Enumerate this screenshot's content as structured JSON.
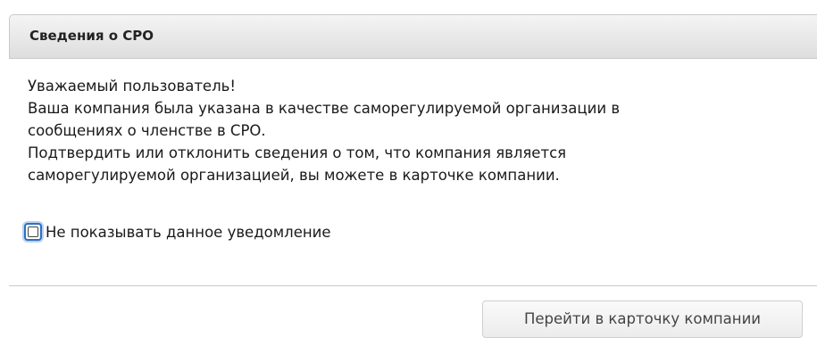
{
  "dialog": {
    "title": "Сведения о СРО",
    "message_lines": [
      "Уважаемый пользователь!",
      "Ваша компания была указана в качестве саморегулируемой организации в",
      "сообщениях о членстве в СРО.",
      "Подтвердить или отклонить сведения о том, что компания является",
      "саморегулируемой организацией, вы можете в карточке компании."
    ],
    "checkbox": {
      "label": "Не показывать данное уведомление",
      "checked": false
    },
    "button_label": "Перейти в карточку компании"
  },
  "colors": {
    "checkbox_focus": "#2a6fc7",
    "header_background": "#e6e6e6",
    "divider": "#c9c9c9"
  },
  "icons": {
    "checkbox": "checkbox-unchecked-icon"
  }
}
